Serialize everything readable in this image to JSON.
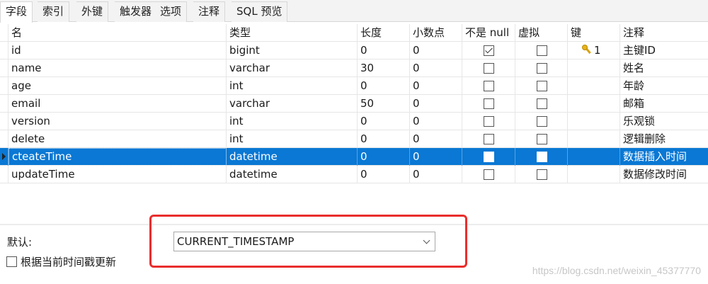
{
  "tabs": [
    "字段",
    "索引",
    "外键",
    "触发器",
    "选项",
    "注释",
    "SQL 预览"
  ],
  "columns": [
    "名",
    "类型",
    "长度",
    "小数点",
    "不是 null",
    "虚拟",
    "键",
    "注释"
  ],
  "rows": [
    {
      "name": "id",
      "type": "bigint",
      "length": "0",
      "decimal": "0",
      "not_null": true,
      "virtual": false,
      "key": "1",
      "comment": "主键ID"
    },
    {
      "name": "name",
      "type": "varchar",
      "length": "30",
      "decimal": "0",
      "not_null": false,
      "virtual": false,
      "key": "",
      "comment": "姓名"
    },
    {
      "name": "age",
      "type": "int",
      "length": "0",
      "decimal": "0",
      "not_null": false,
      "virtual": false,
      "key": "",
      "comment": "年龄"
    },
    {
      "name": "email",
      "type": "varchar",
      "length": "50",
      "decimal": "0",
      "not_null": false,
      "virtual": false,
      "key": "",
      "comment": "邮箱"
    },
    {
      "name": "version",
      "type": "int",
      "length": "0",
      "decimal": "0",
      "not_null": false,
      "virtual": false,
      "key": "",
      "comment": "乐观锁"
    },
    {
      "name": "delete",
      "type": "int",
      "length": "0",
      "decimal": "0",
      "not_null": false,
      "virtual": false,
      "key": "",
      "comment": "逻辑删除"
    },
    {
      "name": "cteateTime",
      "type": "datetime",
      "length": "0",
      "decimal": "0",
      "not_null": false,
      "virtual": false,
      "key": "",
      "comment": "数据插入时间",
      "selected": true
    },
    {
      "name": "updateTime",
      "type": "datetime",
      "length": "0",
      "decimal": "0",
      "not_null": false,
      "virtual": false,
      "key": "",
      "comment": "数据修改时间"
    }
  ],
  "default": {
    "label": "默认:",
    "value": "CURRENT_TIMESTAMP",
    "update_on_timestamp_label": "根据当前时间戳更新",
    "update_on_timestamp_checked": false
  },
  "watermark": "https://blog.csdn.net/weixin_45377770",
  "colors": {
    "selection": "#0a78d4",
    "highlight_box": "#ea2d2d",
    "key_icon": "#e8b21a"
  },
  "icons": {
    "key": "key-icon",
    "row_indicator": "row-pointer-icon",
    "dropdown": "chevron-down-icon"
  }
}
